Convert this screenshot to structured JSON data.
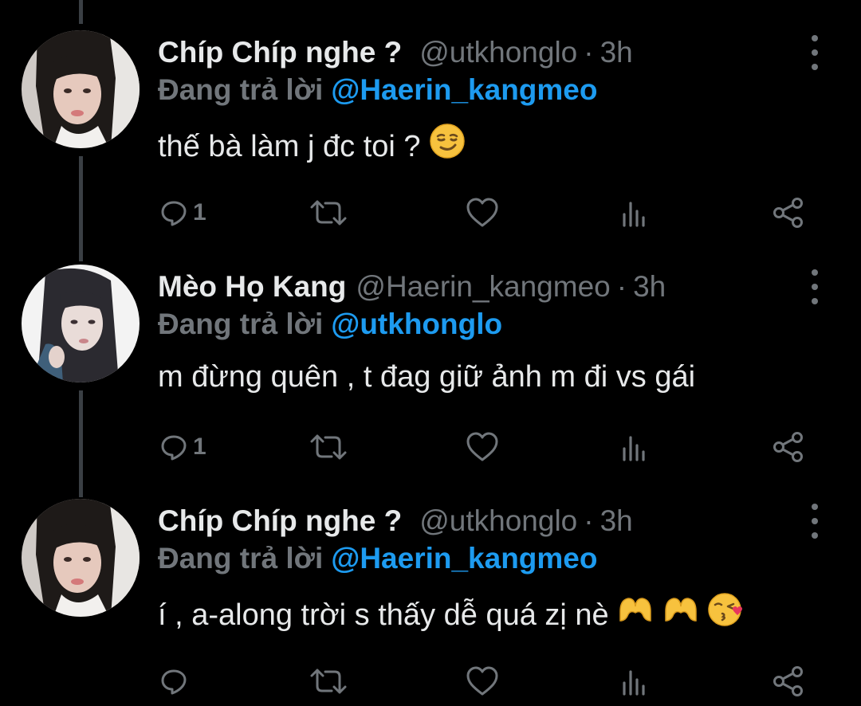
{
  "tweets": [
    {
      "display_name": "Chíp Chíp nghe ?",
      "handle": "@utkhonglo",
      "separator": "·",
      "time": "3h",
      "replying_label": "Đang trả lời",
      "replying_to": "@Haerin_kangmeo",
      "text": "thế bà làm j đc toi ?",
      "emojis": [
        "smirking-face"
      ],
      "reply_count": "1"
    },
    {
      "display_name": "Mèo Họ Kang",
      "handle": "@Haerin_kangmeo",
      "separator": "·",
      "time": "3h",
      "replying_label": "Đang trả lời",
      "replying_to": "@utkhonglo",
      "text": "m đừng quên , t đag giữ ảnh m đi vs gái",
      "emojis": [],
      "reply_count": "1"
    },
    {
      "display_name": "Chíp Chíp nghe ?",
      "handle": "@utkhonglo",
      "separator": "·",
      "time": "3h",
      "replying_label": "Đang trả lời",
      "replying_to": "@Haerin_kangmeo",
      "text": "í , a-along trời s thấy dễ quá zị nè",
      "emojis": [
        "heart-hands",
        "heart-hands",
        "face-blowing-kiss"
      ],
      "reply_count": ""
    }
  ],
  "icons": {
    "reply": "speech-bubble-icon",
    "retweet": "retweet-icon",
    "like": "heart-icon",
    "views": "bar-chart-icon",
    "share": "share-icon",
    "more": "more-vertical-icon"
  },
  "colors": {
    "background": "#000000",
    "text": "#e7e9ea",
    "secondary": "#71767b",
    "mention": "#1d9bf0",
    "thread_line": "#3a3f44"
  }
}
